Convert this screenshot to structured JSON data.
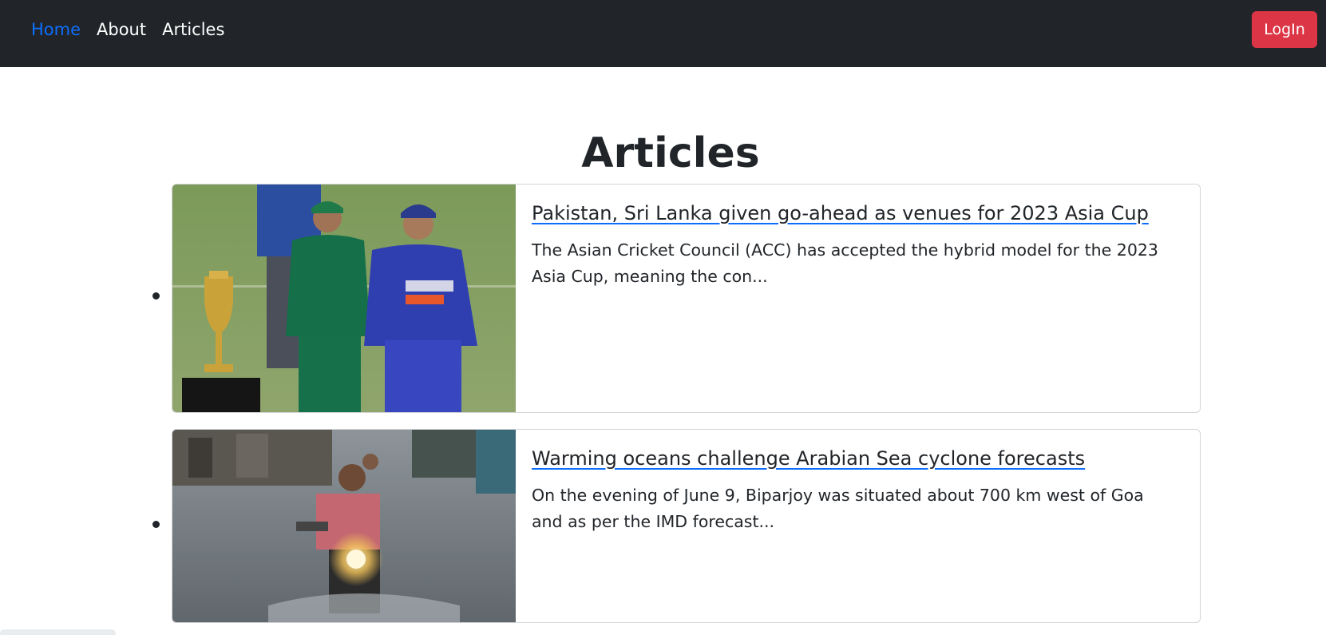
{
  "nav": {
    "links": [
      {
        "label": "Home",
        "active": true
      },
      {
        "label": "About",
        "active": false
      },
      {
        "label": "Articles",
        "active": false
      }
    ],
    "login_label": "LogIn"
  },
  "page": {
    "title": "Articles"
  },
  "articles": [
    {
      "title": "Pakistan, Sri Lanka given go-ahead as venues for 2023 Asia Cup",
      "summary": "The Asian Cricket Council (ACC) has accepted the hybrid model for the 2023 Asia Cup, meaning the con...",
      "image_alt": "cricket-captains-with-trophy"
    },
    {
      "title": "Warming oceans challenge Arabian Sea cyclone forecasts",
      "summary": "On the evening of June 9, Biparjoy was situated about 700 km west of Goa and as per the IMD forecast...",
      "image_alt": "motorcyclist-in-flooded-street"
    }
  ],
  "colors": {
    "navbar_bg": "#212529",
    "link_active": "#0d6efd",
    "login_bg": "#dc3545"
  }
}
